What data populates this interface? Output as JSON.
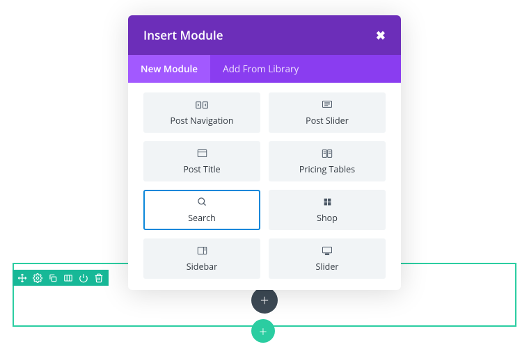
{
  "modal": {
    "title": "Insert Module",
    "tabs": {
      "new": "New Module",
      "library": "Add From Library"
    }
  },
  "modules": {
    "post_navigation": "Post Navigation",
    "post_slider": "Post Slider",
    "post_title": "Post Title",
    "pricing_tables": "Pricing Tables",
    "search": "Search",
    "shop": "Shop",
    "sidebar": "Sidebar",
    "slider": "Slider"
  },
  "buttons": {
    "add_row": "+",
    "add_section": "+"
  }
}
